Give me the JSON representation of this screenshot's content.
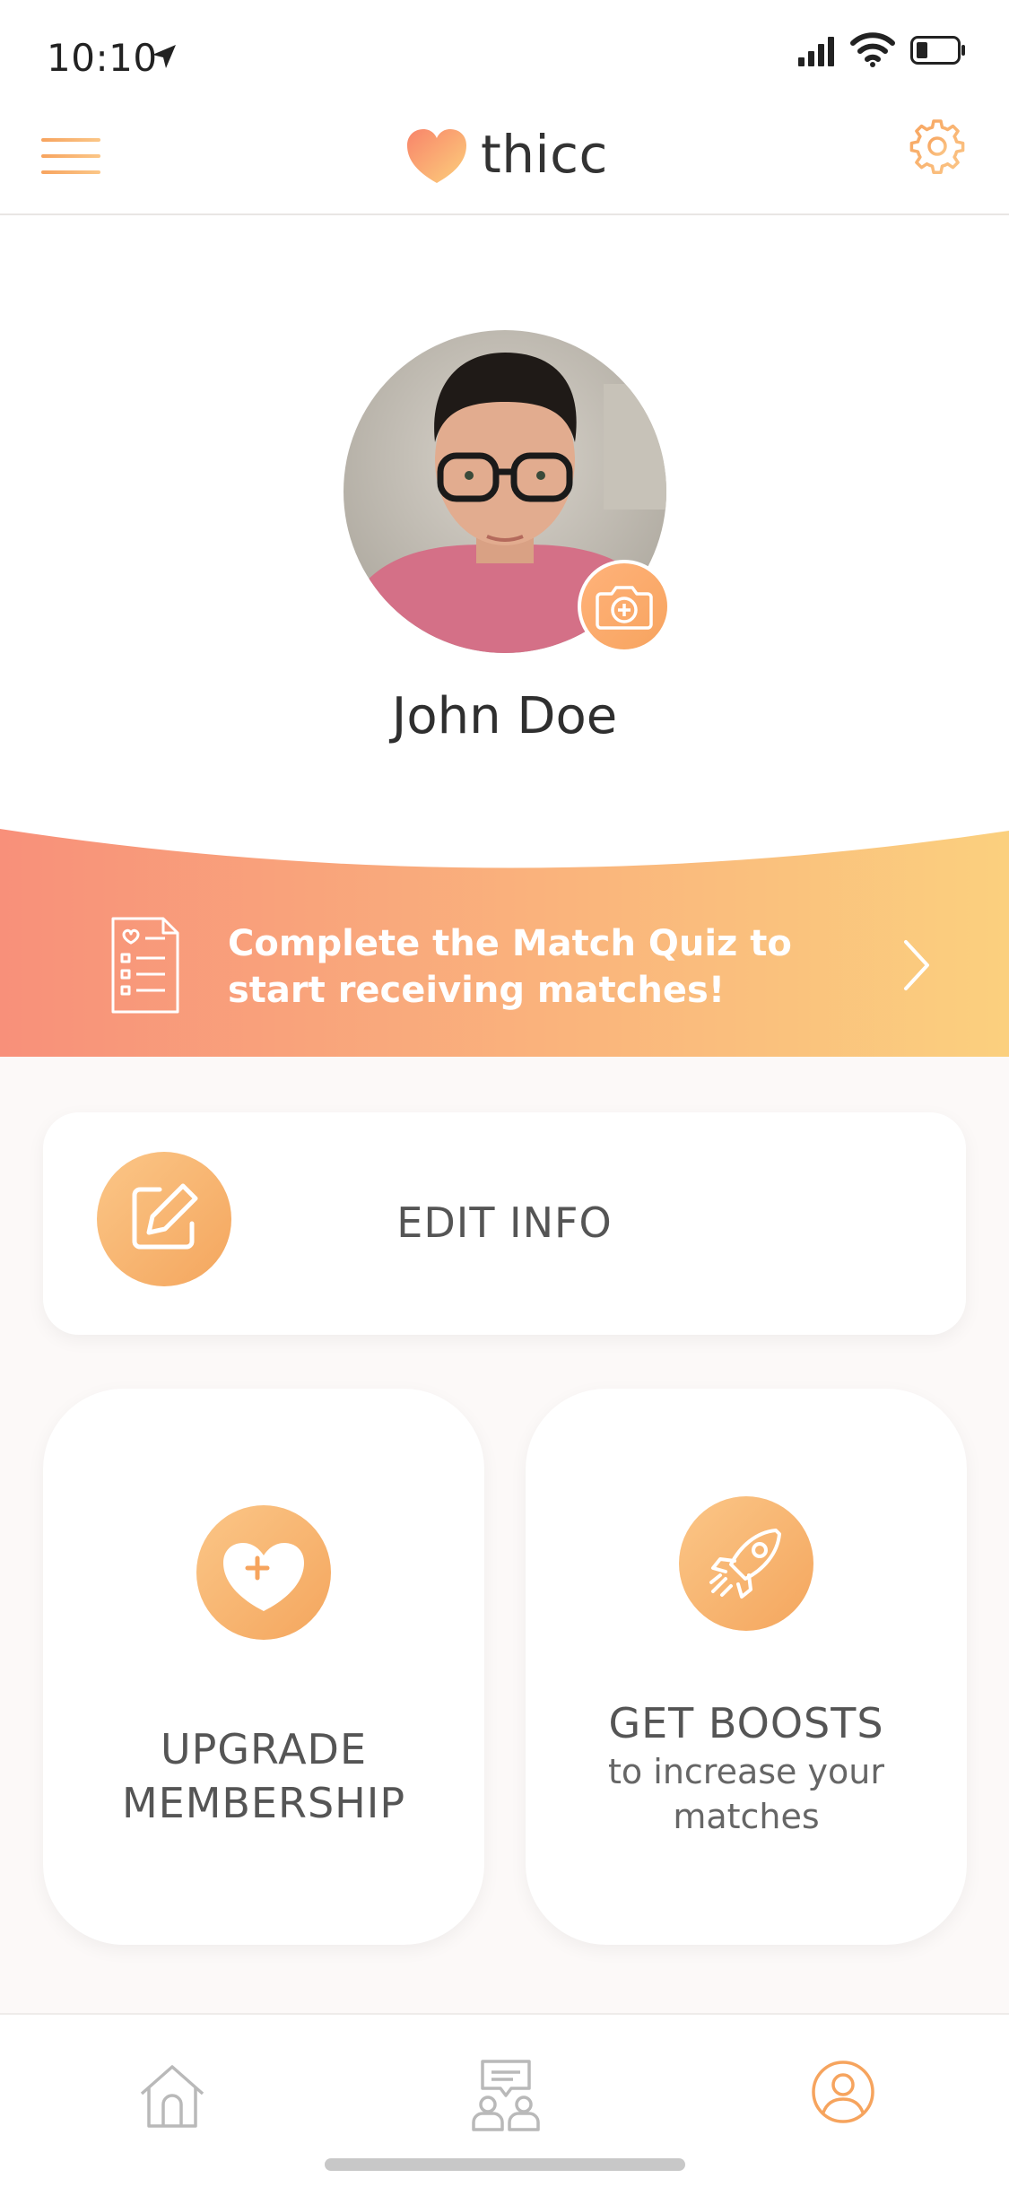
{
  "status_bar": {
    "time": "10:10"
  },
  "header": {
    "app_name": "thicc"
  },
  "profile": {
    "name": "John Doe"
  },
  "banner": {
    "line1": "Complete the Match Quiz to",
    "line2": "start receiving matches!"
  },
  "actions": {
    "edit_info": "EDIT INFO",
    "upgrade_line1": "UPGRADE",
    "upgrade_line2": "MEMBERSHIP",
    "boost_title": "GET BOOSTS",
    "boost_sub1": "to increase your",
    "boost_sub2": "matches"
  },
  "tabs": [
    {
      "icon": "home-icon"
    },
    {
      "icon": "chat-icon"
    },
    {
      "icon": "profile-icon"
    }
  ],
  "colors": {
    "accent": "#f6a45e",
    "banner_start": "#f8907a",
    "banner_end": "#fbd07e"
  }
}
